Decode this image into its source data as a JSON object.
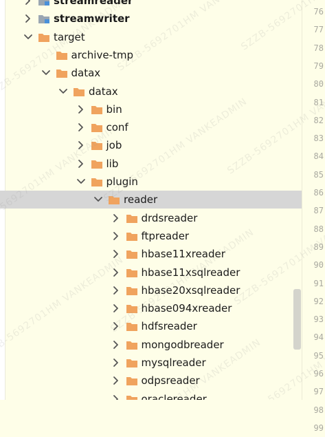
{
  "tree": {
    "items": [
      {
        "label": "streamreader",
        "kind": "module",
        "bold": true,
        "expanded": false,
        "depth": 1
      },
      {
        "label": "streamwriter",
        "kind": "module",
        "bold": true,
        "expanded": false,
        "depth": 1
      },
      {
        "label": "target",
        "kind": "folder",
        "expanded": true,
        "depth": 1
      },
      {
        "label": "archive-tmp",
        "kind": "folder",
        "leaf": true,
        "depth": 2
      },
      {
        "label": "datax",
        "kind": "folder",
        "expanded": true,
        "depth": 2
      },
      {
        "label": "datax",
        "kind": "folder",
        "expanded": true,
        "depth": 3
      },
      {
        "label": "bin",
        "kind": "folder",
        "expanded": false,
        "depth": 4
      },
      {
        "label": "conf",
        "kind": "folder",
        "expanded": false,
        "depth": 4
      },
      {
        "label": "job",
        "kind": "folder",
        "expanded": false,
        "depth": 4
      },
      {
        "label": "lib",
        "kind": "folder",
        "expanded": false,
        "depth": 4
      },
      {
        "label": "plugin",
        "kind": "folder",
        "expanded": true,
        "depth": 4
      },
      {
        "label": "reader",
        "kind": "folder",
        "expanded": true,
        "selected": true,
        "depth": 5
      },
      {
        "label": "drdsreader",
        "kind": "folder",
        "expanded": false,
        "depth": 6
      },
      {
        "label": "ftpreader",
        "kind": "folder",
        "expanded": false,
        "depth": 6
      },
      {
        "label": "hbase11xreader",
        "kind": "folder",
        "expanded": false,
        "depth": 6
      },
      {
        "label": "hbase11xsqlreader",
        "kind": "folder",
        "expanded": false,
        "depth": 6
      },
      {
        "label": "hbase20xsqlreader",
        "kind": "folder",
        "expanded": false,
        "depth": 6
      },
      {
        "label": "hbase094xreader",
        "kind": "folder",
        "expanded": false,
        "depth": 6
      },
      {
        "label": "hdfsreader",
        "kind": "folder",
        "expanded": false,
        "depth": 6
      },
      {
        "label": "mongodbreader",
        "kind": "folder",
        "expanded": false,
        "depth": 6
      },
      {
        "label": "mysqlreader",
        "kind": "folder",
        "expanded": false,
        "depth": 6
      },
      {
        "label": "odpsreader",
        "kind": "folder",
        "expanded": false,
        "depth": 6
      },
      {
        "label": "oraclereader",
        "kind": "folder",
        "expanded": false,
        "depth": 6
      }
    ]
  },
  "gutter": {
    "line_numbers": [
      "76",
      "77",
      "78",
      "79",
      "80",
      "81",
      "82",
      "83",
      "84",
      "85",
      "86",
      "87",
      "88",
      "89",
      "90",
      "91",
      "92",
      "93",
      "94",
      "95",
      "96",
      "97",
      "98",
      "99"
    ]
  },
  "watermark": {
    "text": "SZZB-5692701HM VANKEADMIN"
  },
  "colors": {
    "folder": "#f0a35e",
    "module_icon": "#9aa6b2",
    "selected_row": "#d6d6d6",
    "editor_bg": "#fefee8",
    "text": "#1a1a1a",
    "line_number": "#a9a9a0"
  }
}
